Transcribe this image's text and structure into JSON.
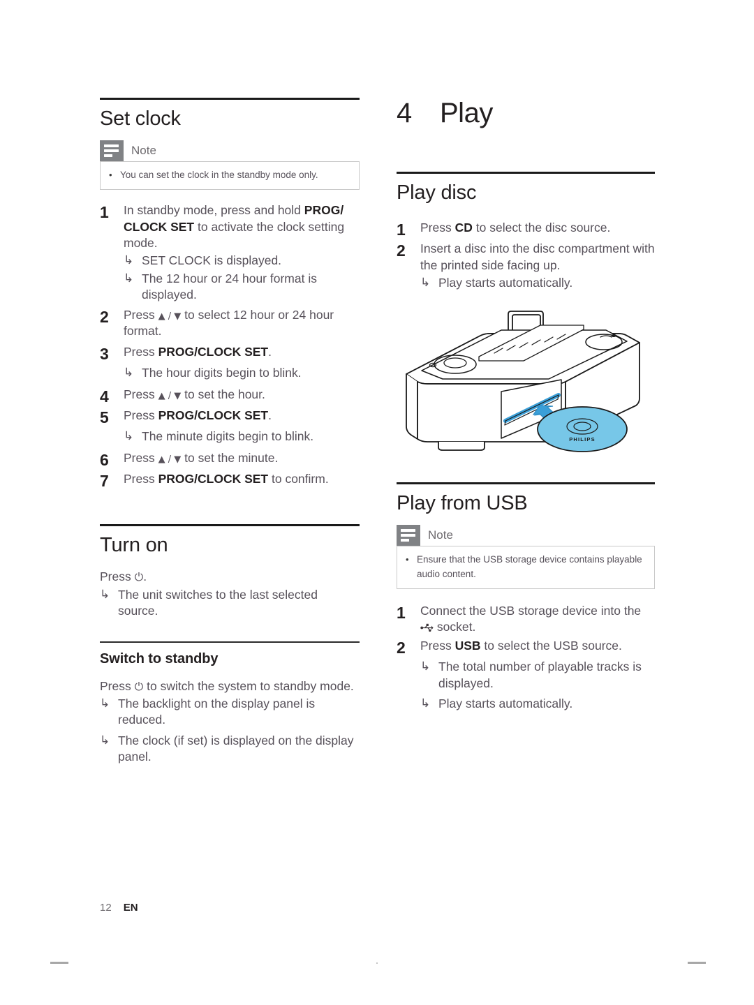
{
  "page": {
    "number": "12",
    "language": "EN"
  },
  "left_column": {
    "set_clock": {
      "heading": "Set clock",
      "note": {
        "title": "Note",
        "items": [
          "You can set the clock in the standby mode only."
        ]
      },
      "steps": [
        {
          "num": "1",
          "text_parts": [
            {
              "t": "In standby mode, press and hold ",
              "bold": false
            },
            {
              "t": "PROG/",
              "bold": true
            },
            {
              "t": "CLOCK SET",
              "bold": true
            },
            {
              "t": " to activate the clock setting mode.",
              "bold": false
            }
          ],
          "plain": "In standby mode, press and hold PROG/CLOCK SET to activate the clock setting mode.",
          "results": [
            "SET CLOCK is displayed.",
            "The 12 hour or 24 hour format is displayed."
          ]
        },
        {
          "num": "2",
          "plain": "Press ▲ / ▼ to select 12 hour or 24 hour format.",
          "results": []
        },
        {
          "num": "3",
          "plain": "Press PROG/CLOCK SET.",
          "results": [
            "The hour digits begin to blink."
          ]
        },
        {
          "num": "4",
          "plain": "Press ▲ / ▼ to set the hour.",
          "results": []
        },
        {
          "num": "5",
          "plain": "Press PROG/CLOCK SET.",
          "results": [
            "The minute digits begin to blink."
          ]
        },
        {
          "num": "6",
          "plain": "Press ▲ / ▼ to set the minute.",
          "results": []
        },
        {
          "num": "7",
          "plain": "Press PROG/CLOCK SET to confirm.",
          "results": []
        }
      ]
    },
    "turn_on": {
      "heading": "Turn on",
      "press_line_prefix": "Press ",
      "press_line_icon": "⏻",
      "press_line_suffix": ".",
      "results": [
        "The unit switches to the last selected source."
      ]
    },
    "switch_to_standby": {
      "heading": "Switch to standby",
      "press_line_prefix": "Press ",
      "press_line_icon": "⏻",
      "press_line_suffix": " to switch the system to standby mode.",
      "results": [
        "The backlight on the display panel is reduced.",
        "The clock (if set) is displayed on the display panel."
      ]
    }
  },
  "right_column": {
    "chapter": {
      "number": "4",
      "title": "Play"
    },
    "play_disc": {
      "heading": "Play disc",
      "steps": [
        {
          "num": "1",
          "pre": "Press ",
          "bold": "CD",
          "post": " to select the disc source.",
          "results": []
        },
        {
          "num": "2",
          "pre": "Insert a disc into the disc compartment with the printed side facing up.",
          "bold": "",
          "post": "",
          "results": [
            "Play starts automatically."
          ]
        }
      ],
      "illustration": {
        "name": "docking-speaker-cd-insert",
        "disc_label": "PHILIPS",
        "disc_color": "#77c7e8",
        "arrow_color": "#3a9fd8",
        "outline_color": "#1a1a1a"
      }
    },
    "play_from_usb": {
      "heading": "Play from USB",
      "note": {
        "title": "Note",
        "items": [
          "Ensure that the USB storage device contains playable audio content."
        ]
      },
      "steps": [
        {
          "num": "1",
          "pre": "Connect the USB storage device into the ",
          "icon": "usb-icon",
          "post": " socket.",
          "results": []
        },
        {
          "num": "2",
          "pre": "Press ",
          "bold": "USB",
          "post": " to select the USB source.",
          "results": [
            "The total number of playable tracks is displayed.",
            "Play starts automatically."
          ]
        }
      ]
    }
  },
  "colors": {
    "heading_text": "#231f20",
    "body_text": "#57515a",
    "note_icon_bg": "#808285",
    "rule": "#1a1a1a"
  }
}
